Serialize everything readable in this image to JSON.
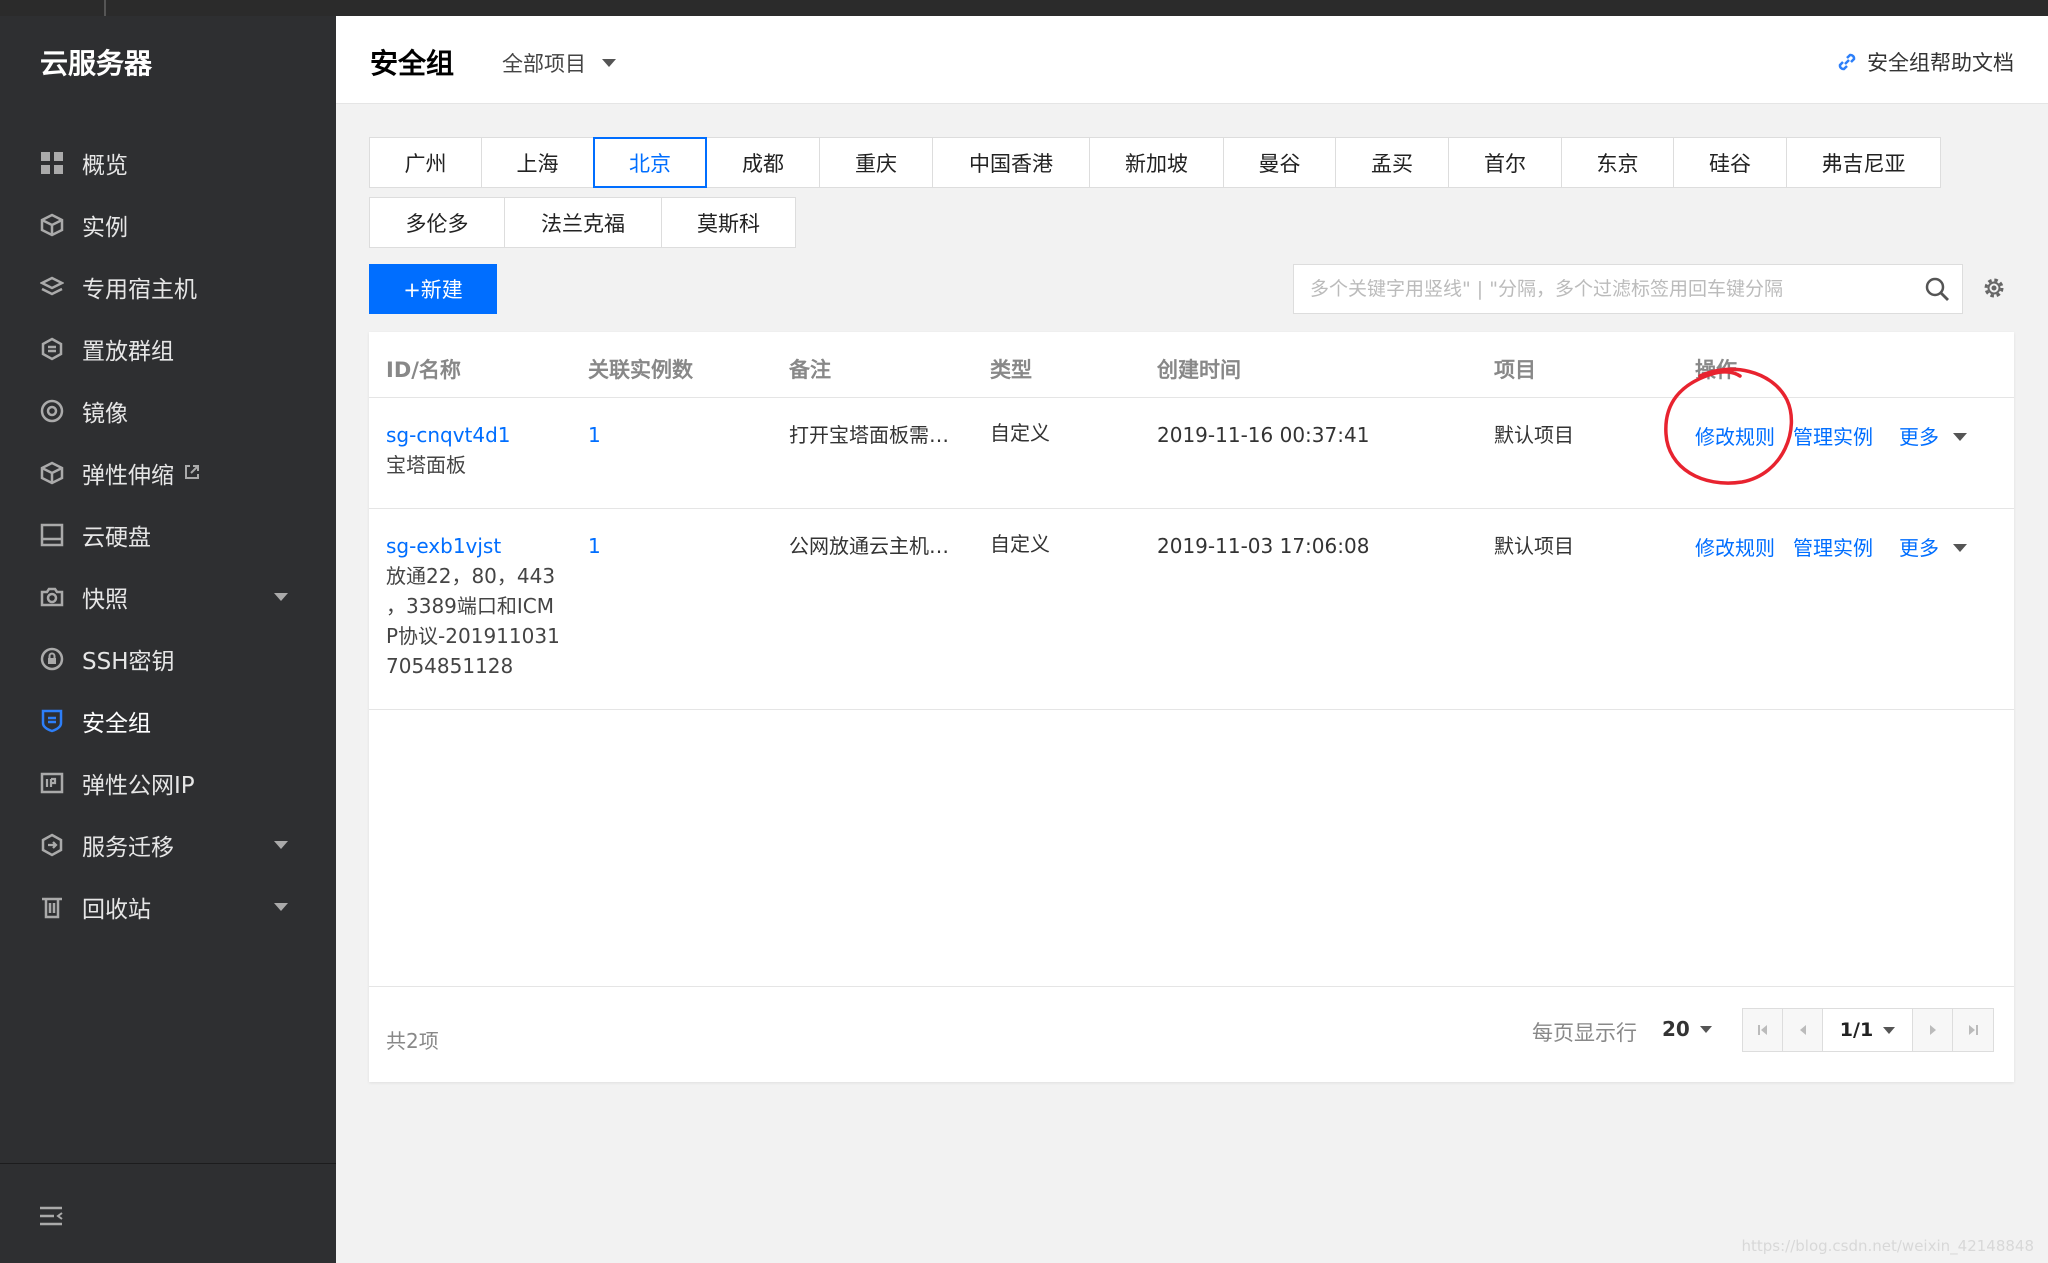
{
  "sidebar": {
    "brand": "云服务器",
    "items": [
      {
        "label": "概览",
        "icon": "grid-icon"
      },
      {
        "label": "实例",
        "icon": "cube-icon"
      },
      {
        "label": "专用宿主机",
        "icon": "layers-icon"
      },
      {
        "label": "置放群组",
        "icon": "group-icon"
      },
      {
        "label": "镜像",
        "icon": "disc-icon"
      },
      {
        "label": "弹性伸缩",
        "icon": "scaling-icon"
      },
      {
        "label": "云硬盘",
        "icon": "disk-icon"
      },
      {
        "label": "快照",
        "icon": "camera-icon"
      },
      {
        "label": "SSH密钥",
        "icon": "key-icon"
      },
      {
        "label": "安全组",
        "icon": "shield-icon"
      },
      {
        "label": "弹性公网IP",
        "icon": "ip-icon"
      },
      {
        "label": "服务迁移",
        "icon": "migrate-icon"
      },
      {
        "label": "回收站",
        "icon": "trash-icon"
      }
    ],
    "active_index": 9
  },
  "header": {
    "title": "安全组",
    "project_filter": "全部项目",
    "help_link": "安全组帮助文档"
  },
  "regions": {
    "row1": [
      "广州",
      "上海",
      "北京",
      "成都",
      "重庆",
      "中国香港",
      "新加坡",
      "曼谷",
      "孟买",
      "首尔",
      "东京",
      "硅谷",
      "弗吉尼亚"
    ],
    "row2": [
      "多伦多",
      "法兰克福",
      "莫斯科"
    ],
    "active": "北京"
  },
  "toolbar": {
    "new_button": "+新建",
    "search_placeholder": "多个关键字用竖线\" | \"分隔，多个过滤标签用回车键分隔"
  },
  "table": {
    "columns": [
      "ID/名称",
      "关联实例数",
      "备注",
      "类型",
      "创建时间",
      "项目",
      "操作"
    ],
    "rows": [
      {
        "id": "sg-cnqvt4d1",
        "name_lines": [
          "宝塔面板"
        ],
        "instances": "1",
        "remark": "打开宝塔面板需…",
        "type": "自定义",
        "created": "2019-11-16 00:37:41",
        "project": "默认项目",
        "actions": {
          "edit": "修改规则",
          "manage": "管理实例",
          "more": "更多"
        }
      },
      {
        "id": "sg-exb1vjst",
        "name_lines": [
          "放通22，80，443",
          "，3389端口和ICM",
          "P协议-201911031",
          "7054851128"
        ],
        "instances": "1",
        "remark": "公网放通云主机…",
        "type": "自定义",
        "created": "2019-11-03 17:06:08",
        "project": "默认项目",
        "actions": {
          "edit": "修改规则",
          "manage": "管理实例",
          "more": "更多"
        }
      }
    ]
  },
  "footer": {
    "total": "共2项",
    "per_page_label": "每页显示行",
    "per_page": "20",
    "page": "1/1"
  },
  "watermark": "https://blog.csdn.net/weixin_42148848",
  "colors": {
    "accent": "#006eff",
    "sidebar_bg": "#2e2f31",
    "annotation": "#e8232f"
  }
}
